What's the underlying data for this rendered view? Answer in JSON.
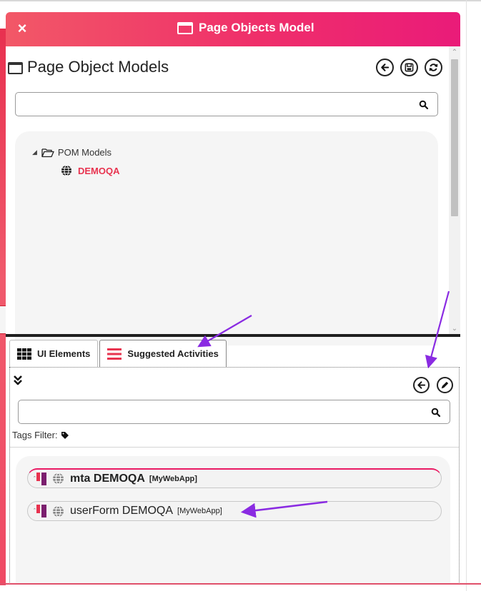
{
  "window": {
    "title": "Page Objects Model",
    "close_label": "×"
  },
  "pom_panel": {
    "heading": "Page Object Models",
    "search_placeholder": "",
    "tree": {
      "root_label": "POM Models",
      "child_label": "DEMOQA"
    }
  },
  "tabs": [
    {
      "label": "UI Elements"
    },
    {
      "label": "Suggested Activities"
    }
  ],
  "elements_panel": {
    "search_placeholder": "",
    "tags_filter_label": "Tags Filter:",
    "items": [
      {
        "name": "mta DEMOQA",
        "type": "[MyWebApp]"
      },
      {
        "name": "userForm DEMOQA",
        "type": "[MyWebApp]"
      }
    ]
  },
  "colors": {
    "title_gradient_start": "#f25867",
    "title_gradient_end": "#ea1b79",
    "accent_red": "#e8334f",
    "arrow_purple": "#8a2be2"
  },
  "icons": {
    "back": "arrow-left-circle-icon",
    "save": "save-icon",
    "refresh": "refresh-icon",
    "edit": "pencil-icon",
    "search": "search-icon"
  }
}
